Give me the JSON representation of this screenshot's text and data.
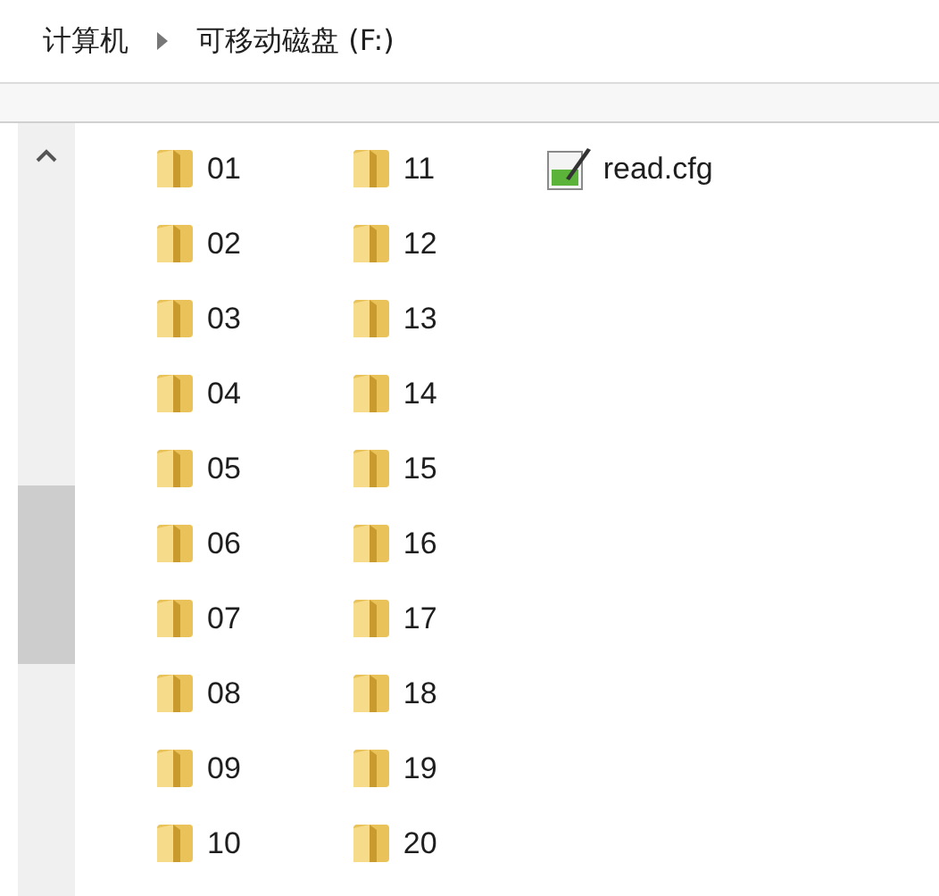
{
  "breadcrumb": [
    {
      "label": "计算机"
    },
    {
      "label": "可移动磁盘 (F:)"
    }
  ],
  "items": [
    {
      "kind": "folder",
      "name": "01"
    },
    {
      "kind": "folder",
      "name": "02"
    },
    {
      "kind": "folder",
      "name": "03"
    },
    {
      "kind": "folder",
      "name": "04"
    },
    {
      "kind": "folder",
      "name": "05"
    },
    {
      "kind": "folder",
      "name": "06"
    },
    {
      "kind": "folder",
      "name": "07"
    },
    {
      "kind": "folder",
      "name": "08"
    },
    {
      "kind": "folder",
      "name": "09"
    },
    {
      "kind": "folder",
      "name": "10"
    },
    {
      "kind": "folder",
      "name": "11"
    },
    {
      "kind": "folder",
      "name": "12"
    },
    {
      "kind": "folder",
      "name": "13"
    },
    {
      "kind": "folder",
      "name": "14"
    },
    {
      "kind": "folder",
      "name": "15"
    },
    {
      "kind": "folder",
      "name": "16"
    },
    {
      "kind": "folder",
      "name": "17"
    },
    {
      "kind": "folder",
      "name": "18"
    },
    {
      "kind": "folder",
      "name": "19"
    },
    {
      "kind": "folder",
      "name": "20"
    },
    {
      "kind": "file",
      "name": "read.cfg"
    }
  ]
}
